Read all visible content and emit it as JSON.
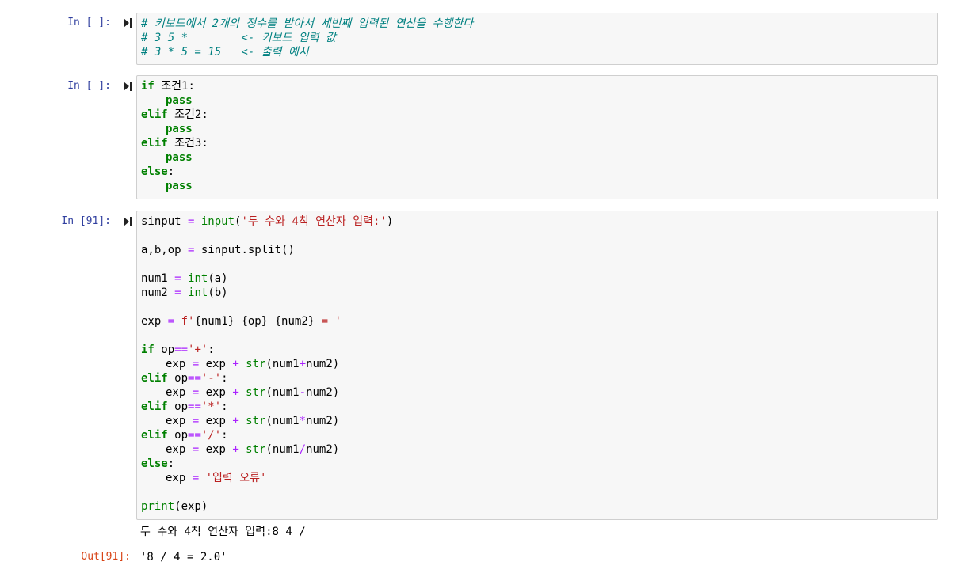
{
  "cells": [
    {
      "prompt": "In [ ]:",
      "comment1": "# 키보드에서 2개의 정수를 받아서 세번째 입력된 연산을 수행한다",
      "comment2": "# 3 5 *        <- 키보드 입력 값",
      "comment3": "# 3 * 5 = 15   <- 출력 예시"
    },
    {
      "prompt": "In [ ]:",
      "kw_if": "if",
      "cond1": " 조건1:",
      "kw_pass": "pass",
      "kw_elif": "elif",
      "cond2": " 조건2:",
      "cond3": " 조건3:",
      "kw_else": "else",
      "colon": ":"
    },
    {
      "prompt": "In [91]:",
      "l1_var": "sinput ",
      "l1_eq": "=",
      "l1_fn": " input",
      "l1_open": "(",
      "l1_str": "'두 수와 4칙 연산자 입력:'",
      "l1_close": ")",
      "l2_a": "a,b,op ",
      "l2_eq": "=",
      "l2_b": " sinput.split()",
      "l3_a": "num1 ",
      "l3_eq": "=",
      "l3_fn": " int",
      "l3_b": "(a)",
      "l4_a": "num2 ",
      "l4_eq": "=",
      "l4_fn": " int",
      "l4_b": "(b)",
      "l5_a": "exp ",
      "l5_eq": "=",
      "l5_str1": " f'",
      "l5_mid": "{num1} {op} {num2}",
      "l5_str2": " = '",
      "if_kw": "if",
      "elif_kw": "elif",
      "else_kw": "else",
      "op_prefix": " op",
      "eqeq": "==",
      "s_plus": "'+'",
      "s_minus": "'-'",
      "s_mul": "'*'",
      "s_div": "'/'",
      "colon": ":",
      "exp_lhs": "exp ",
      "exp_eq": "=",
      "exp_mid": " exp ",
      "plus": "+",
      "str_fn": " str",
      "num_open": "(num1",
      "minus": "-",
      "star": "*",
      "slash": "/",
      "num_close": "num2)",
      "err_str": " '입력 오류'",
      "print_fn": "print",
      "print_arg": "(exp)",
      "stdout": "두 수와 4칙 연산자 입력:8 4 /",
      "out_prompt": "Out[91]:",
      "result": "'8 / 4 = 2.0'"
    }
  ]
}
